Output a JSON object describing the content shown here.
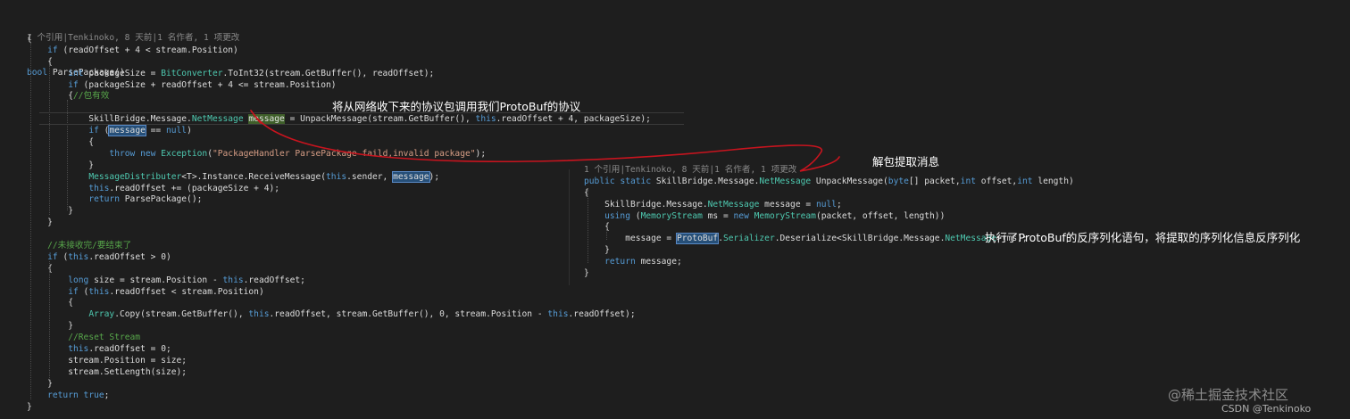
{
  "left_code": {
    "header": "1 个引用|Tenkinoko, 8 天前|1 名作者, 1 项更改",
    "lines": [
      "bool ParsePackage()",
      "{",
      "if (readOffset + 4 < stream.Position)",
      "{",
      "int packageSize = BitConverter.ToInt32(stream.GetBuffer(), readOffset);",
      "if (packageSize + readOffset + 4 <= stream.Position)",
      "{//包有效",
      "",
      "SkillBridge.Message.NetMessage message = UnpackMessage(stream.GetBuffer(), this.readOffset + 4, packageSize);",
      "if (message == null)",
      "{",
      "throw new Exception(\"PackageHandler ParsePackage faild,invalid package\");",
      "}",
      "MessageDistributer<T>.Instance.ReceiveMessage(this.sender, message);",
      "this.readOffset += (packageSize + 4);",
      "return ParsePackage();",
      "}",
      "}",
      "",
      "//未接收完/要结束了",
      "if (this.readOffset > 0)",
      "{",
      "long size = stream.Position - this.readOffset;",
      "if (this.readOffset < stream.Position)",
      "{",
      "Array.Copy(stream.GetBuffer(), this.readOffset, stream.GetBuffer(), 0, stream.Position - this.readOffset);",
      "}",
      "//Reset Stream",
      "this.readOffset = 0;",
      "stream.Position = size;",
      "stream.SetLength(size);",
      "}",
      "return true;",
      "}"
    ]
  },
  "right_code": {
    "header": "1 个引用|Tenkinoko, 8 天前|1 名作者, 1 项更改",
    "lines": [
      "public static SkillBridge.Message.NetMessage UnpackMessage(byte[] packet,int offset,int length)",
      "{",
      "SkillBridge.Message.NetMessage message = null;",
      "using (MemoryStream ms = new MemoryStream(packet, offset, length))",
      "{",
      "message = ProtoBuf.Serializer.Deserialize<SkillBridge.Message.NetMessage>(ms);",
      "}",
      "return message;",
      "}"
    ]
  },
  "annotations": {
    "call_note": "将从网络收下来的协议包调用我们ProtoBuf的协议",
    "unpack_note": "解包提取消息",
    "deserialize_note": "执行了ProtoBuf的反序列化语句，将提取的序列化信息反序列化"
  },
  "watermarks": {
    "juejin": "@稀土掘金技术社区",
    "csdn": "CSDN @Tenkinoko"
  },
  "colors": {
    "background": "#1e1e1e",
    "keyword": "#569cd6",
    "type": "#4ec9b0",
    "string": "#d69d85",
    "comment": "#57a64a",
    "ink": "#c8141e"
  }
}
